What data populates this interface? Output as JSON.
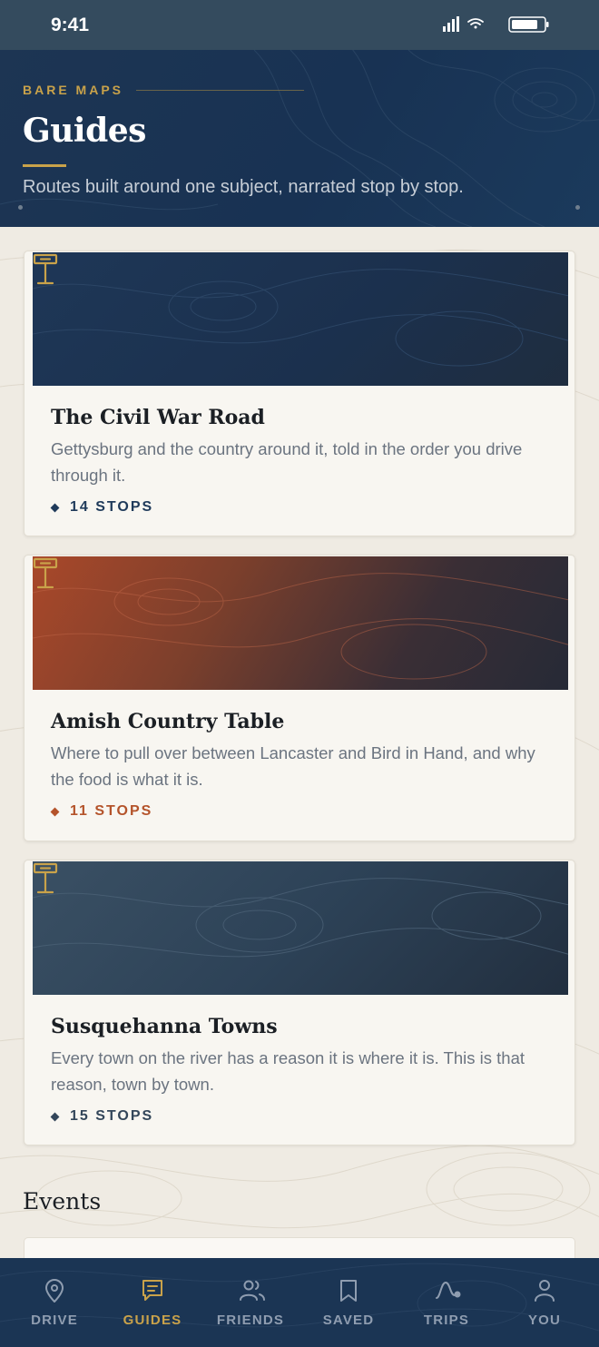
{
  "status_bar": {
    "time": "9:41"
  },
  "header": {
    "brand": "BARE MAPS",
    "title": "Guides",
    "subtitle": "Routes built around one subject, narrated stop by stop."
  },
  "guides": [
    {
      "title": "The Civil War Road",
      "description": "Gettysburg and the country around it, told in the order you drive through it.",
      "stops": "14 STOPS",
      "accent": "#1f3a5a",
      "icon": "signpost-icon"
    },
    {
      "title": "Amish Country Table",
      "description": "Where to pull over between Lancaster and Bird in Hand, and why the food is what it is.",
      "stops": "11 STOPS",
      "accent": "#b4532a",
      "icon": "signpost-icon"
    },
    {
      "title": "Susquehanna Towns",
      "description": "Every town on the river has a reason it is where it is. This is that reason, town by town.",
      "stops": "15 STOPS",
      "accent": "#33465a",
      "icon": "signpost-icon"
    }
  ],
  "events": {
    "title": "Events"
  },
  "tab_bar": {
    "tabs": [
      {
        "label": "DRIVE",
        "icon": "map-pin-icon"
      },
      {
        "label": "GUIDES",
        "icon": "guide-icon",
        "active": true
      },
      {
        "label": "FRIENDS",
        "icon": "friends-icon"
      },
      {
        "label": "SAVED",
        "icon": "bookmark-icon"
      },
      {
        "label": "TRIPS",
        "icon": "route-icon"
      },
      {
        "label": "YOU",
        "icon": "person-icon"
      }
    ]
  },
  "colors": {
    "gold": "#c9a24a",
    "navy": "#1b3554",
    "rust": "#b4532a",
    "slate": "#33465a"
  }
}
